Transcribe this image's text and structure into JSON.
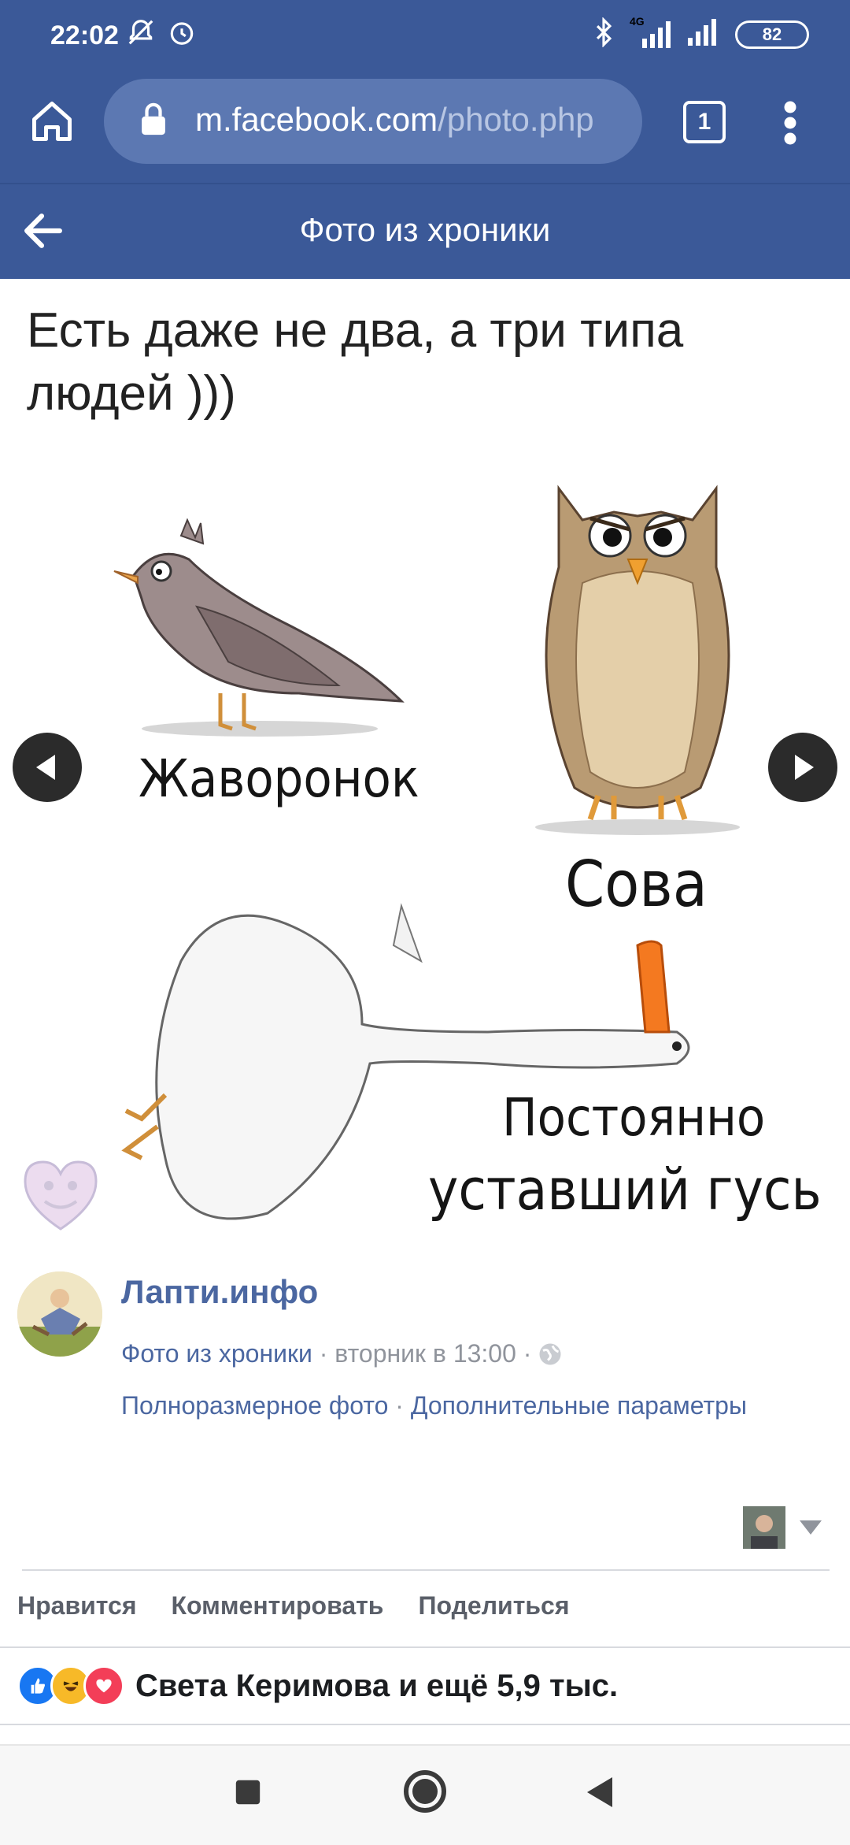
{
  "status_bar": {
    "time": "22:02",
    "battery": "82",
    "network_label": "4G"
  },
  "browser": {
    "url_host": "m.facebook.com",
    "url_path": "/photo.php",
    "tab_count": "1"
  },
  "header": {
    "title": "Фото из хроники"
  },
  "photo": {
    "caption": "Есть даже не два, а три типа людей )))",
    "labels": {
      "lark": "Жаворонок",
      "owl": "Сова",
      "goose_line1": "Постоянно",
      "goose_line2": "уставший гусь"
    }
  },
  "post": {
    "page_name": "Лапти.инфо",
    "album": "Фото из хроники",
    "separator": "·",
    "time": "вторник в 13:00",
    "full_size_link": "Полноразмерное фото",
    "more_options_link": "Дополнительные параметры"
  },
  "actions": {
    "like": "Нравится",
    "comment": "Комментировать",
    "share": "Поделиться"
  },
  "reactions": {
    "summary": "Света Керимова и ещё 5,9 тыс."
  },
  "colors": {
    "brand": "#3b5998",
    "link": "#4b67a1",
    "gray": "#90949c"
  }
}
